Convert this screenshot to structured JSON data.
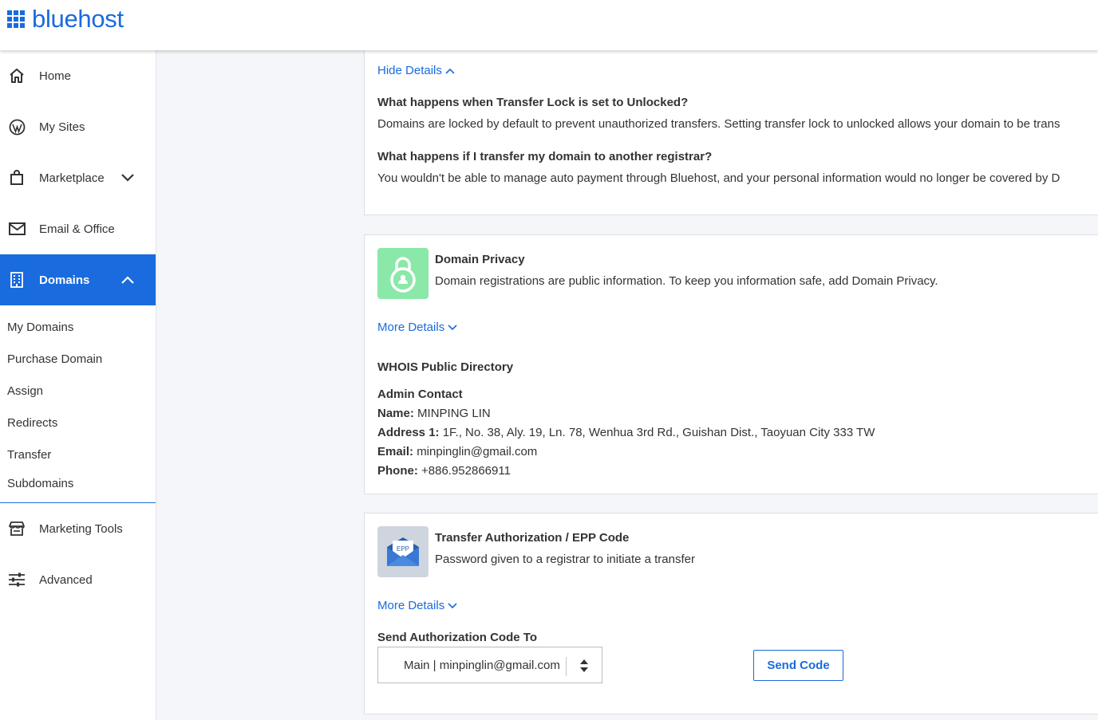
{
  "brand": {
    "name": "bluehost",
    "color": "#196bde"
  },
  "sidebar": {
    "items": [
      {
        "label": "Home",
        "icon": "home-icon"
      },
      {
        "label": "My Sites",
        "icon": "wordpress-icon"
      },
      {
        "label": "Marketplace",
        "icon": "shopping-bag-icon"
      },
      {
        "label": "Email & Office",
        "icon": "envelope-icon"
      },
      {
        "label": "Domains",
        "icon": "building-icon",
        "active": true
      },
      {
        "label": "Marketing Tools",
        "icon": "storefront-icon"
      },
      {
        "label": "Advanced",
        "icon": "sliders-icon"
      }
    ],
    "domains_sub": [
      "My Domains",
      "Purchase Domain",
      "Assign",
      "Redirects",
      "Transfer",
      "Subdomains"
    ]
  },
  "transfer_lock": {
    "hide_details": "Hide Details",
    "q1": "What happens when Transfer Lock is set to Unlocked?",
    "a1": "Domains are locked by default to prevent unauthorized transfers. Setting transfer lock to unlocked allows your domain to be trans",
    "q2": "What happens if I transfer my domain to another registrar?",
    "a2": "You wouldn't be able to manage auto payment through Bluehost, and your personal information would no longer be covered by D"
  },
  "privacy": {
    "title": "Domain Privacy",
    "desc": "Domain registrations are public information. To keep you information safe, add Domain Privacy.",
    "more": "More Details",
    "whois_title": "WHOIS Public Directory",
    "contact_title": "Admin Contact",
    "name_label": "Name:",
    "name": "MINPING LIN",
    "address_label": "Address 1:",
    "address": "1F., No. 38, Aly. 19, Ln. 78, Wenhua 3rd Rd., Guishan Dist., Taoyuan City 333 TW",
    "email_label": "Email:",
    "email": "minpinglin@gmail.com",
    "phone_label": "Phone:",
    "phone": "+886.952866911",
    "icon_bg": "#8ae8a8"
  },
  "epp": {
    "title": "Transfer Authorization / EPP Code",
    "desc": "Password given to a registrar to initiate a transfer",
    "more": "More Details",
    "icon_text": "EPP",
    "send_label": "Send Authorization Code To",
    "select_value": "Main | minpinglin@gmail.com",
    "send_button": "Send Code"
  }
}
